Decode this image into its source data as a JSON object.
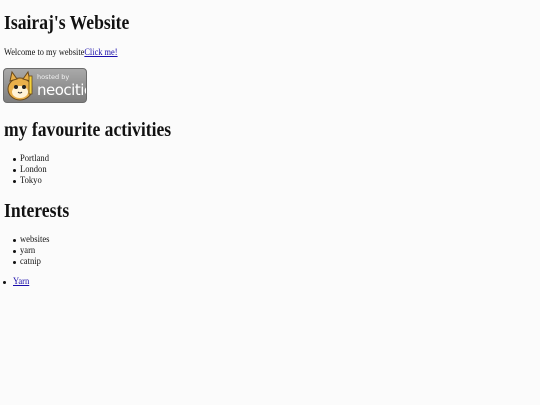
{
  "site": {
    "title": "Isairaj's Website",
    "welcome_text": "Welcome to my website",
    "welcome_link": "Click me!"
  },
  "badge": {
    "line1": "hosted by",
    "line2": "neocities",
    "icon": "neocities-cat-icon"
  },
  "activities": {
    "heading": "my favourite activities",
    "items": [
      "Portland",
      "London",
      "Tokyo"
    ]
  },
  "interests": {
    "heading": "Interests",
    "items": [
      "websites",
      "yarn",
      "catnip"
    ]
  },
  "links": {
    "items": [
      "Yarn"
    ]
  }
}
